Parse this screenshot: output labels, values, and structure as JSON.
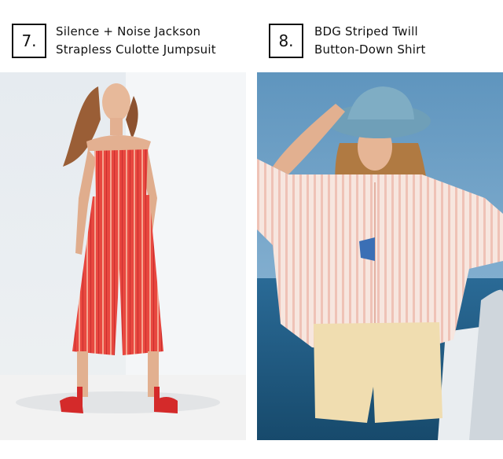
{
  "items": [
    {
      "number": "7.",
      "title_line1": "Silence + Noise Jackson",
      "title_line2": "Strapless Culotte Jumpsuit",
      "image_alt": "Model in red striped strapless culotte jumpsuit with red heeled sandals"
    },
    {
      "number": "8.",
      "title_line1": "BDG Striped Twill",
      "title_line2": "Button-Down Shirt",
      "image_alt": "Model in pink striped button-down shirt, denim bucket hat and yellow shorts on a boat"
    }
  ],
  "colors": {
    "jumpsuit_red": "#e8473f",
    "stripe_pink": "#f3c3b8",
    "sky_blue": "#6e9fc4",
    "sea_blue": "#1f5a82",
    "shorts_yellow": "#f0ddb0"
  }
}
